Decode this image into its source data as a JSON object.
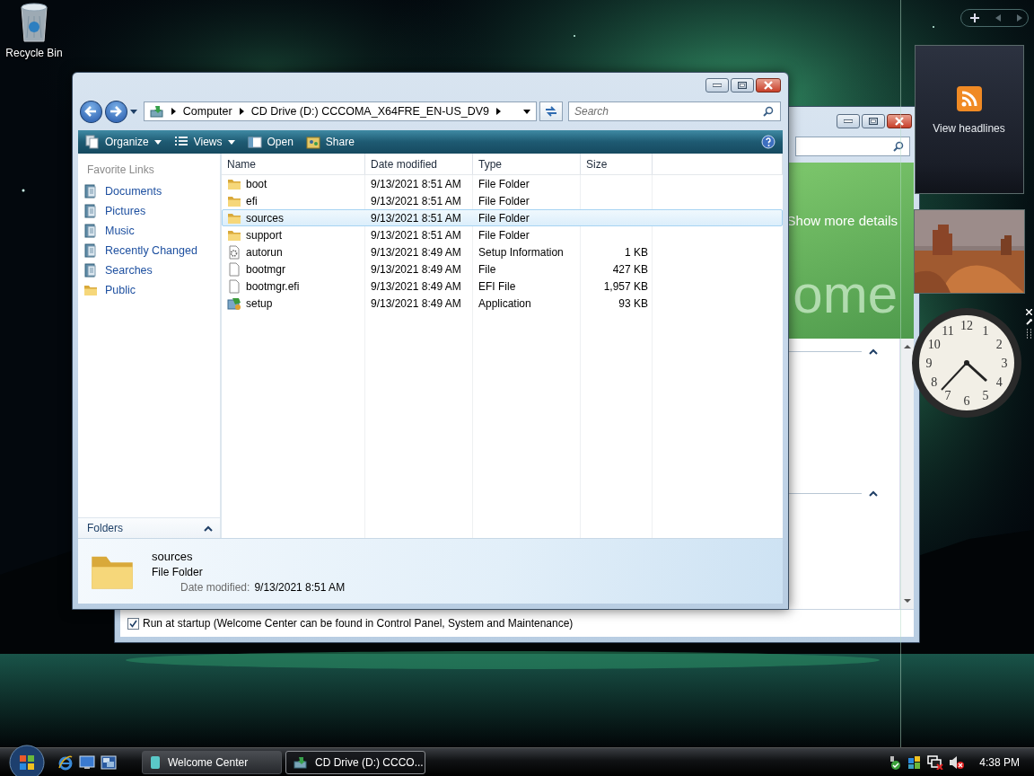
{
  "desktop": {
    "icons": [
      {
        "label": "Recycle Bin"
      }
    ]
  },
  "welcome_window": {
    "banner_link": "Show more details",
    "banner_title": "ome",
    "startup": {
      "label": "Run at startup (Welcome Center can be found in Control Panel, System and Maintenance)",
      "checked": true
    }
  },
  "explorer": {
    "address": {
      "segments": [
        "Computer",
        "CD Drive (D:) CCCOMA_X64FRE_EN-US_DV9"
      ]
    },
    "search": {
      "placeholder": "Search"
    },
    "toolbar": [
      {
        "label": "Organize",
        "kind": "menu"
      },
      {
        "label": "Views",
        "kind": "menu"
      },
      {
        "label": "Open",
        "kind": "button"
      },
      {
        "label": "Share",
        "kind": "button"
      }
    ],
    "favorite_links": {
      "title": "Favorite Links",
      "items": [
        {
          "label": "Documents",
          "kind": "library"
        },
        {
          "label": "Pictures",
          "kind": "library"
        },
        {
          "label": "Music",
          "kind": "library"
        },
        {
          "label": "Recently Changed",
          "kind": "library"
        },
        {
          "label": "Searches",
          "kind": "library"
        },
        {
          "label": "Public",
          "kind": "folder"
        }
      ]
    },
    "folders_label": "Folders",
    "table": {
      "columns": [
        "Name",
        "Date modified",
        "Type",
        "Size"
      ],
      "rows": [
        {
          "kind": "folder",
          "name": "boot",
          "date": "9/13/2021 8:51 AM",
          "type": "File Folder",
          "selected": false
        },
        {
          "kind": "folder",
          "name": "efi",
          "date": "9/13/2021 8:51 AM",
          "type": "File Folder",
          "selected": false
        },
        {
          "kind": "folder",
          "name": "sources",
          "date": "9/13/2021 8:51 AM",
          "type": "File Folder",
          "selected": true
        },
        {
          "kind": "folder",
          "name": "support",
          "date": "9/13/2021 8:51 AM",
          "type": "File Folder",
          "selected": false
        },
        {
          "kind": "settings",
          "name": "autorun",
          "date": "9/13/2021 8:49 AM",
          "type": "Setup Information",
          "size": "1 KB",
          "selected": false
        },
        {
          "kind": "file",
          "name": "bootmgr",
          "date": "9/13/2021 8:49 AM",
          "type": "File",
          "size": "427 KB",
          "selected": false
        },
        {
          "kind": "file",
          "name": "bootmgr.efi",
          "date": "9/13/2021 8:49 AM",
          "type": "EFI File",
          "size": "1,957 KB",
          "selected": false
        },
        {
          "kind": "app",
          "name": "setup",
          "date": "9/13/2021 8:49 AM",
          "type": "Application",
          "size": "93 KB",
          "selected": false
        }
      ]
    },
    "details": {
      "name": "sources",
      "type": "File Folder",
      "date_label": "Date modified:",
      "date": "9/13/2021 8:51 AM"
    }
  },
  "gadgets": {
    "feed": {
      "label": "View headlines"
    },
    "clock": {
      "numerals": [
        "12",
        "1",
        "2",
        "3",
        "4",
        "5",
        "6",
        "7",
        "8",
        "9",
        "10",
        "11"
      ]
    }
  },
  "taskbar": {
    "buttons": [
      {
        "label": "Welcome Center",
        "kind": "welcome",
        "selected": false
      },
      {
        "label": "CD Drive (D:) CCCO...",
        "kind": "drive",
        "selected": true
      }
    ],
    "time": "4:38 PM"
  }
}
